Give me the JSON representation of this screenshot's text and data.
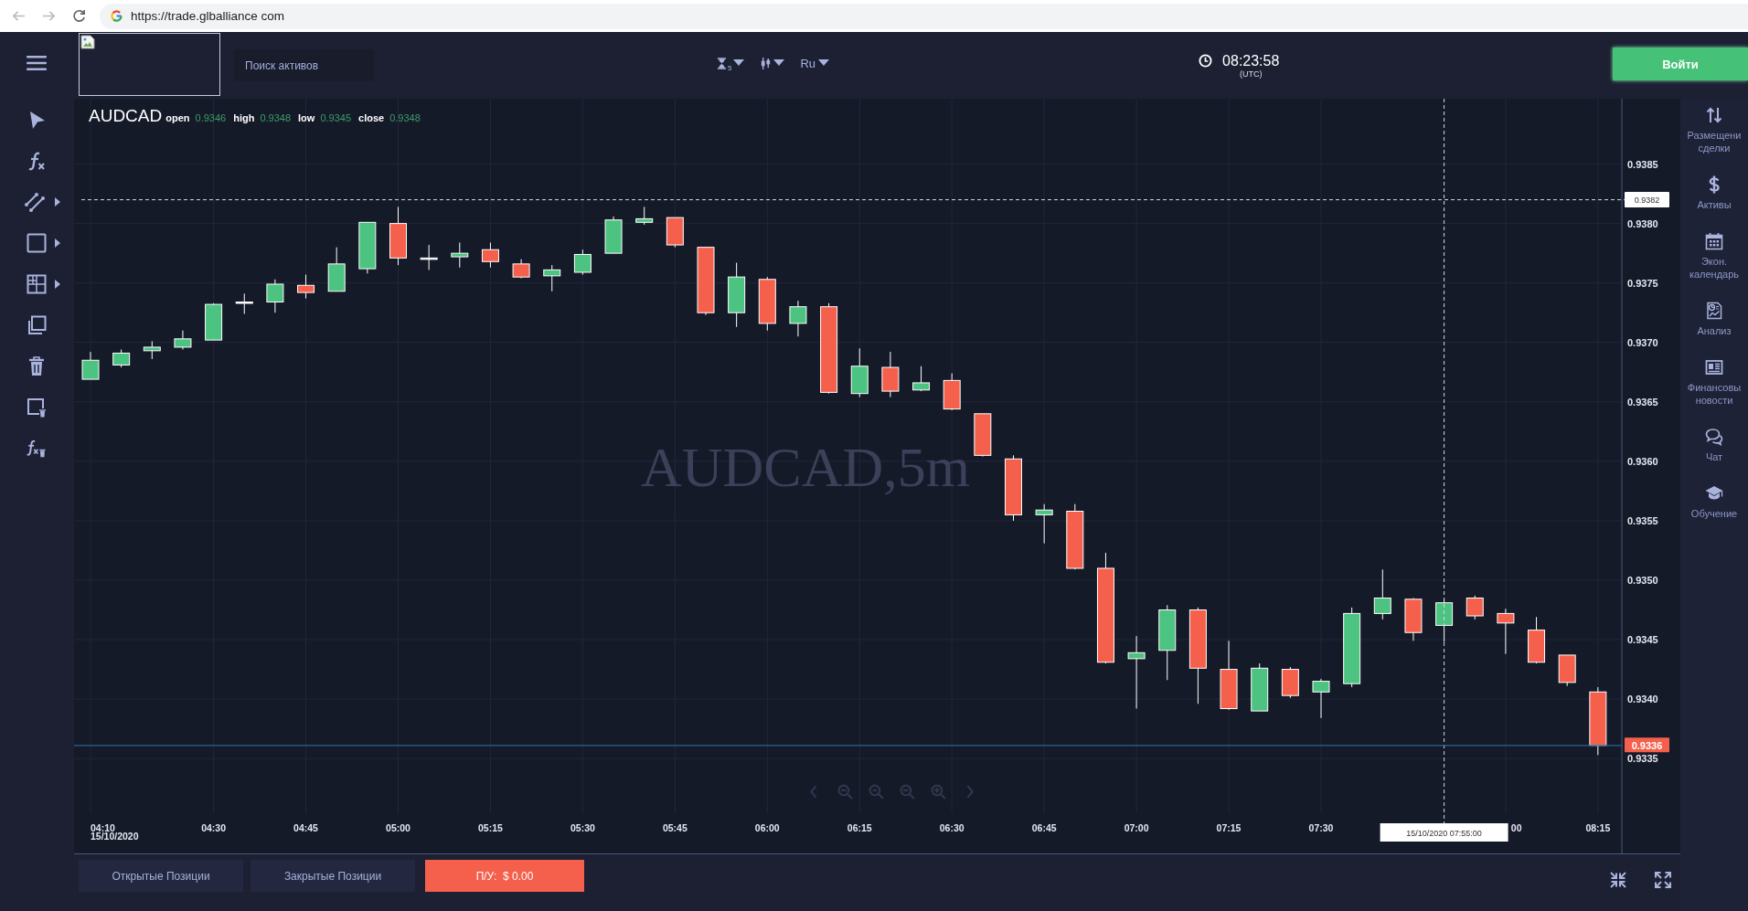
{
  "browser": {
    "url": "https://trade.glballiance com"
  },
  "header": {
    "search": {
      "placeholder": "Поиск активов"
    },
    "timeframe": "5",
    "language": "Ru",
    "clock": {
      "time": "08:23:58",
      "zone": "(UTC)"
    },
    "login_button": "Войти"
  },
  "chart": {
    "symbol": "AUDCAD",
    "ohlc": [
      {
        "label": "open",
        "value": "0.9346"
      },
      {
        "label": "high",
        "value": "0.9348"
      },
      {
        "label": "low",
        "value": "0.9345"
      },
      {
        "label": "close",
        "value": "0.9348"
      }
    ],
    "watermark": "AUDCAD,5m",
    "price_axis": [
      "0.9385",
      "0.9380",
      "0.9375",
      "0.9370",
      "0.9365",
      "0.9360",
      "0.9355",
      "0.9350",
      "0.9345",
      "0.9340",
      "0.9335"
    ],
    "crosshair": {
      "price_label": "0.9382",
      "time_label": "15/10/2020 07:55:00"
    },
    "current_price": "0.9336",
    "time_axis": [
      "04:10",
      "04:30",
      "04:45",
      "05:00",
      "05:15",
      "05:30",
      "05:45",
      "06:00",
      "06:15",
      "06:30",
      "06:45",
      "07:00",
      "07:15",
      "07:30",
      "00",
      "08:15"
    ],
    "start_date": "15/10/2020"
  },
  "right_sidebar": [
    {
      "label": "Размещени сделки"
    },
    {
      "label": "Активы"
    },
    {
      "label": "Экон. календарь"
    },
    {
      "label": "Анализ"
    },
    {
      "label": "Финансовы новости"
    },
    {
      "label": "Чат"
    },
    {
      "label": "Обучение"
    }
  ],
  "bottom_bar": {
    "position_buttons": [
      "Открытые Позиции",
      "Закрытые Позиции"
    ],
    "pnl": "П/У:  $ 0.00"
  }
}
